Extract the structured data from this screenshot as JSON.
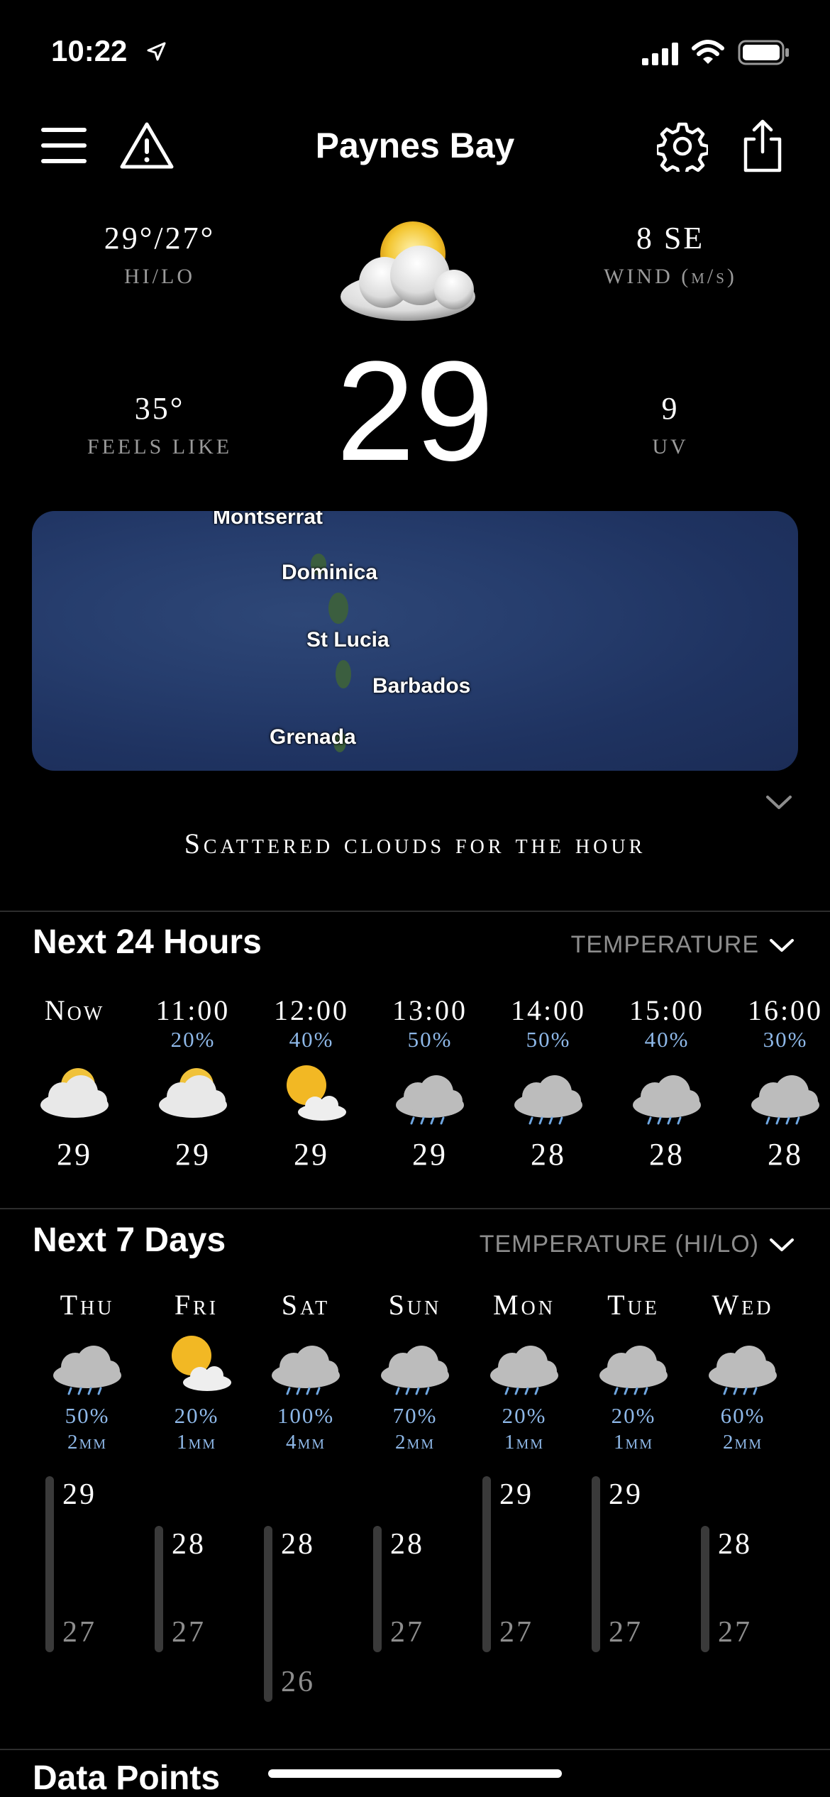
{
  "status_bar": {
    "time": "10:22"
  },
  "header": {
    "location": "Paynes Bay"
  },
  "current": {
    "hilo": "29°/27°",
    "hilo_label": "HI/LO",
    "wind": "8 SE",
    "wind_label": "WIND (m/s)",
    "feels": "35°",
    "feels_label": "FEELS LIKE",
    "uv": "9",
    "uv_label": "UV",
    "temp": "29",
    "icon": "partly-cloudy-icon"
  },
  "map": {
    "labels": [
      "Montserrat",
      "Dominica",
      "St Lucia",
      "Barbados",
      "Grenada"
    ]
  },
  "summary": "Scattered clouds for the hour",
  "hourly": {
    "title": "Next 24 Hours",
    "selector": "TEMPERATURE",
    "items": [
      {
        "time": "Now",
        "pop": "",
        "temp": "29",
        "icon": "partly-cloudy"
      },
      {
        "time": "11:00",
        "pop": "20%",
        "temp": "29",
        "icon": "partly-cloudy"
      },
      {
        "time": "12:00",
        "pop": "40%",
        "temp": "29",
        "icon": "sun-cloud"
      },
      {
        "time": "13:00",
        "pop": "50%",
        "temp": "29",
        "icon": "rain"
      },
      {
        "time": "14:00",
        "pop": "50%",
        "temp": "28",
        "icon": "rain"
      },
      {
        "time": "15:00",
        "pop": "40%",
        "temp": "28",
        "icon": "rain"
      },
      {
        "time": "16:00",
        "pop": "30%",
        "temp": "28",
        "icon": "rain"
      }
    ]
  },
  "daily": {
    "title": "Next 7 Days",
    "selector": "TEMPERATURE (HI/LO)",
    "items": [
      {
        "day": "Thu",
        "pop": "50%",
        "mm": "2mm",
        "hi": "29",
        "lo": "27",
        "icon": "rain"
      },
      {
        "day": "Fri",
        "pop": "20%",
        "mm": "1mm",
        "hi": "28",
        "lo": "27",
        "icon": "sun-cloud"
      },
      {
        "day": "Sat",
        "pop": "100%",
        "mm": "4mm",
        "hi": "28",
        "lo": "26",
        "icon": "rain"
      },
      {
        "day": "Sun",
        "pop": "70%",
        "mm": "2mm",
        "hi": "28",
        "lo": "27",
        "icon": "rain"
      },
      {
        "day": "Mon",
        "pop": "20%",
        "mm": "1mm",
        "hi": "29",
        "lo": "27",
        "icon": "rain"
      },
      {
        "day": "Tue",
        "pop": "20%",
        "mm": "1mm",
        "hi": "29",
        "lo": "27",
        "icon": "rain"
      },
      {
        "day": "Wed",
        "pop": "60%",
        "mm": "2mm",
        "hi": "28",
        "lo": "27",
        "icon": "rain"
      }
    ]
  },
  "data_points": {
    "title": "Data Points"
  }
}
